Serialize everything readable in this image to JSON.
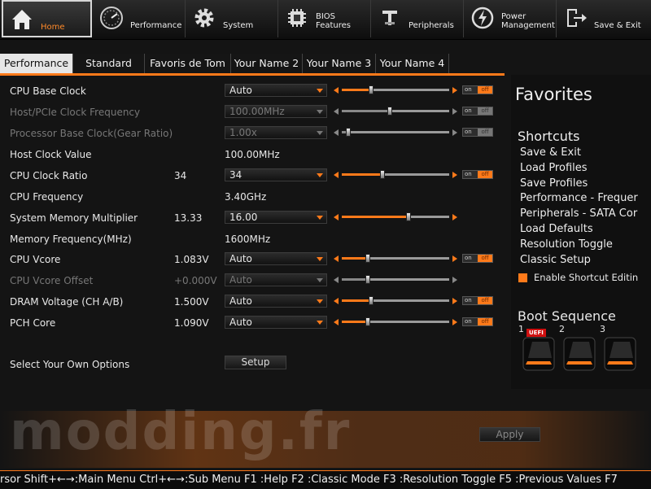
{
  "main_menu": [
    {
      "label": "Home",
      "icon": "home-icon"
    },
    {
      "label": "Performance",
      "icon": "gauge-icon"
    },
    {
      "label": "System",
      "icon": "gear-icon"
    },
    {
      "label": "BIOS\nFeatures",
      "icon": "bios-chip-icon"
    },
    {
      "label": "Peripherals",
      "icon": "peripherals-icon"
    },
    {
      "label": "Power\nManagement",
      "icon": "power-icon"
    },
    {
      "label": "Save & Exit",
      "icon": "exit-door-icon"
    }
  ],
  "sub_tabs": [
    "Performance",
    "Standard",
    "Favoris de Tom",
    "Your Name 2",
    "Your Name 3",
    "Your Name 4"
  ],
  "settings": [
    {
      "name": "CPU Base Clock",
      "value": "",
      "control": "Auto",
      "has_slider": true,
      "slider": 0.27,
      "has_toggle": true,
      "dim": false
    },
    {
      "name": "Host/PCIe Clock Frequency",
      "value": "",
      "control": "100.00MHz",
      "has_slider": true,
      "slider": 0.45,
      "has_toggle": true,
      "dim": true
    },
    {
      "name": "Processor Base Clock(Gear Ratio)",
      "value": "",
      "control": "1.00x",
      "has_slider": true,
      "slider": 0.06,
      "has_toggle": true,
      "dim": true
    },
    {
      "name": "Host Clock Value",
      "value": "",
      "static": "100.00MHz"
    },
    {
      "name": "CPU Clock Ratio",
      "value": "34",
      "control": "34",
      "has_slider": true,
      "slider": 0.38,
      "has_toggle": true,
      "dim": false
    },
    {
      "name": "CPU Frequency",
      "value": "",
      "static": "3.40GHz"
    },
    {
      "name": "System Memory Multiplier",
      "value": "13.33",
      "control": "16.00",
      "has_slider": true,
      "slider": 0.62,
      "has_toggle": false,
      "dim": false
    },
    {
      "name": "Memory Frequency(MHz)",
      "value": "",
      "static": "1600MHz"
    },
    {
      "name": "CPU Vcore",
      "value": "1.083V",
      "control": "Auto",
      "has_slider": true,
      "slider": 0.24,
      "has_toggle": true,
      "dim": false
    },
    {
      "name": "CPU Vcore Offset",
      "value": "+0.000V",
      "control": "Auto",
      "has_slider": true,
      "slider": 0.24,
      "has_toggle": false,
      "dim": true
    },
    {
      "name": "DRAM Voltage     (CH A/B)",
      "value": "1.500V",
      "control": "Auto",
      "has_slider": true,
      "slider": 0.27,
      "has_toggle": true,
      "dim": false
    },
    {
      "name": "PCH Core",
      "value": "1.090V",
      "control": "Auto",
      "has_slider": true,
      "slider": 0.24,
      "has_toggle": true,
      "dim": false
    }
  ],
  "toggle_on": "on",
  "toggle_off": "off",
  "own_options": {
    "label": "Select Your Own Options",
    "button": "Setup"
  },
  "apply_button": "Apply",
  "favorites": {
    "title": "Favorites",
    "shortcuts_title": "Shortcuts",
    "shortcuts": [
      "Save & Exit",
      "Load Profiles",
      "Save Profiles",
      "Performance - Frequer",
      "Peripherals - SATA Cor",
      "Load Defaults",
      "Resolution Toggle",
      "Classic Setup"
    ],
    "enable_label": "Enable Shortcut Editin"
  },
  "boot": {
    "title": "Boot Sequence",
    "slots": [
      {
        "num": "1",
        "badge": "UEFI"
      },
      {
        "num": "2",
        "badge": ""
      },
      {
        "num": "3",
        "badge": ""
      }
    ]
  },
  "watermark": "modding.fr",
  "help_bar": "rsor Shift+←→:Main Menu Ctrl+←→:Sub Menu F1 :Help F2 :Classic Mode F3 :Resolution Toggle F5 :Previous Values F7",
  "colors": {
    "accent": "#ff7a1a",
    "background": "#141414",
    "text": "#e8e8e8",
    "dim_text": "#777777"
  }
}
